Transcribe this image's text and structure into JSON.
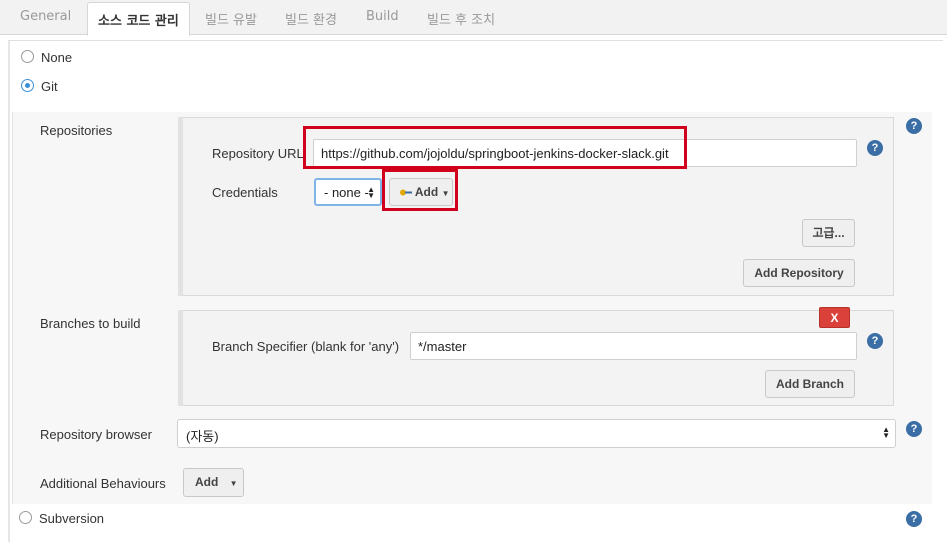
{
  "tabs": [
    {
      "label": "General"
    },
    {
      "label": "소스 코드 관리"
    },
    {
      "label": "빌드 유발"
    },
    {
      "label": "빌드 환경"
    },
    {
      "label": "Build"
    },
    {
      "label": "빌드 후 조치"
    }
  ],
  "scm": {
    "none_label": "None",
    "git_label": "Git",
    "subversion_label": "Subversion",
    "selected": "Git"
  },
  "repositories": {
    "section_label": "Repositories",
    "url_label": "Repository URL",
    "url_value": "https://github.com/jojoldu/springboot-jenkins-docker-slack.git",
    "credentials_label": "Credentials",
    "credentials_value": "- none -",
    "add_credentials_label": "Add",
    "advanced_label": "고급...",
    "add_repository_label": "Add Repository"
  },
  "branches": {
    "section_label": "Branches to build",
    "delete_label": "X",
    "specifier_label": "Branch Specifier (blank for 'any')",
    "specifier_value": "*/master",
    "add_branch_label": "Add Branch"
  },
  "browser": {
    "label": "Repository browser",
    "value": "(자동)"
  },
  "behaviours": {
    "label": "Additional Behaviours",
    "add_label": "Add"
  },
  "help_glyph": "?",
  "colors": {
    "highlight": "#d0021b",
    "radio_selected": "#3b8fd8",
    "help_icon": "#3a6ea5",
    "delete_button": "#d9413a"
  }
}
